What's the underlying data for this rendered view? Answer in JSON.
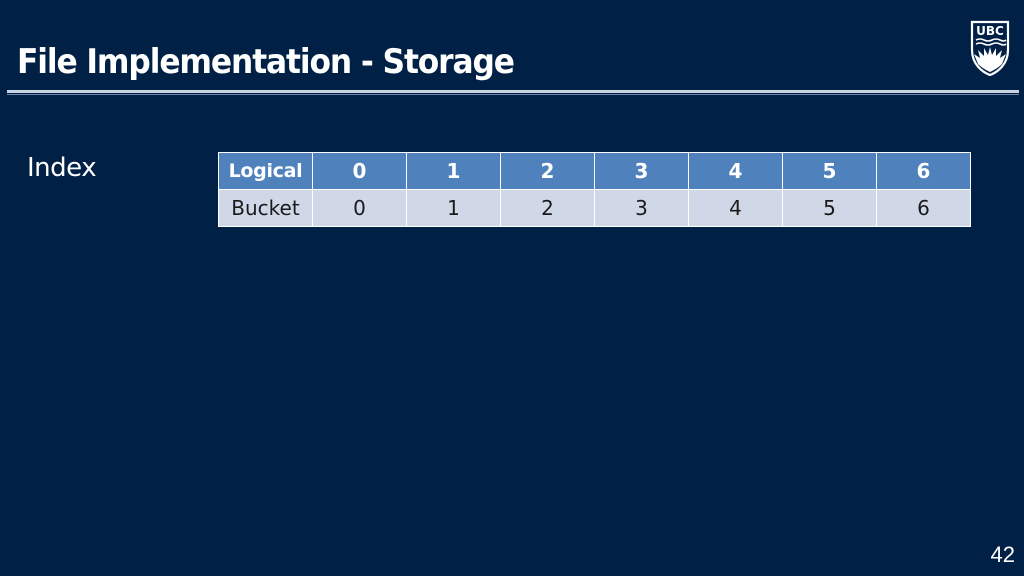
{
  "slide": {
    "title": "File Implementation - Storage",
    "logo_text": "UBC",
    "index_label": "Index",
    "page_number": "42"
  },
  "table": {
    "header": {
      "label": "Logical",
      "values": [
        "0",
        "1",
        "2",
        "3",
        "4",
        "5",
        "6"
      ]
    },
    "row": {
      "label": "Bucket",
      "values": [
        "0",
        "1",
        "2",
        "3",
        "4",
        "5",
        "6"
      ]
    }
  },
  "colors": {
    "background": "#002145",
    "header_fill": "#4f81bd",
    "row_fill": "#d0d8e8"
  }
}
